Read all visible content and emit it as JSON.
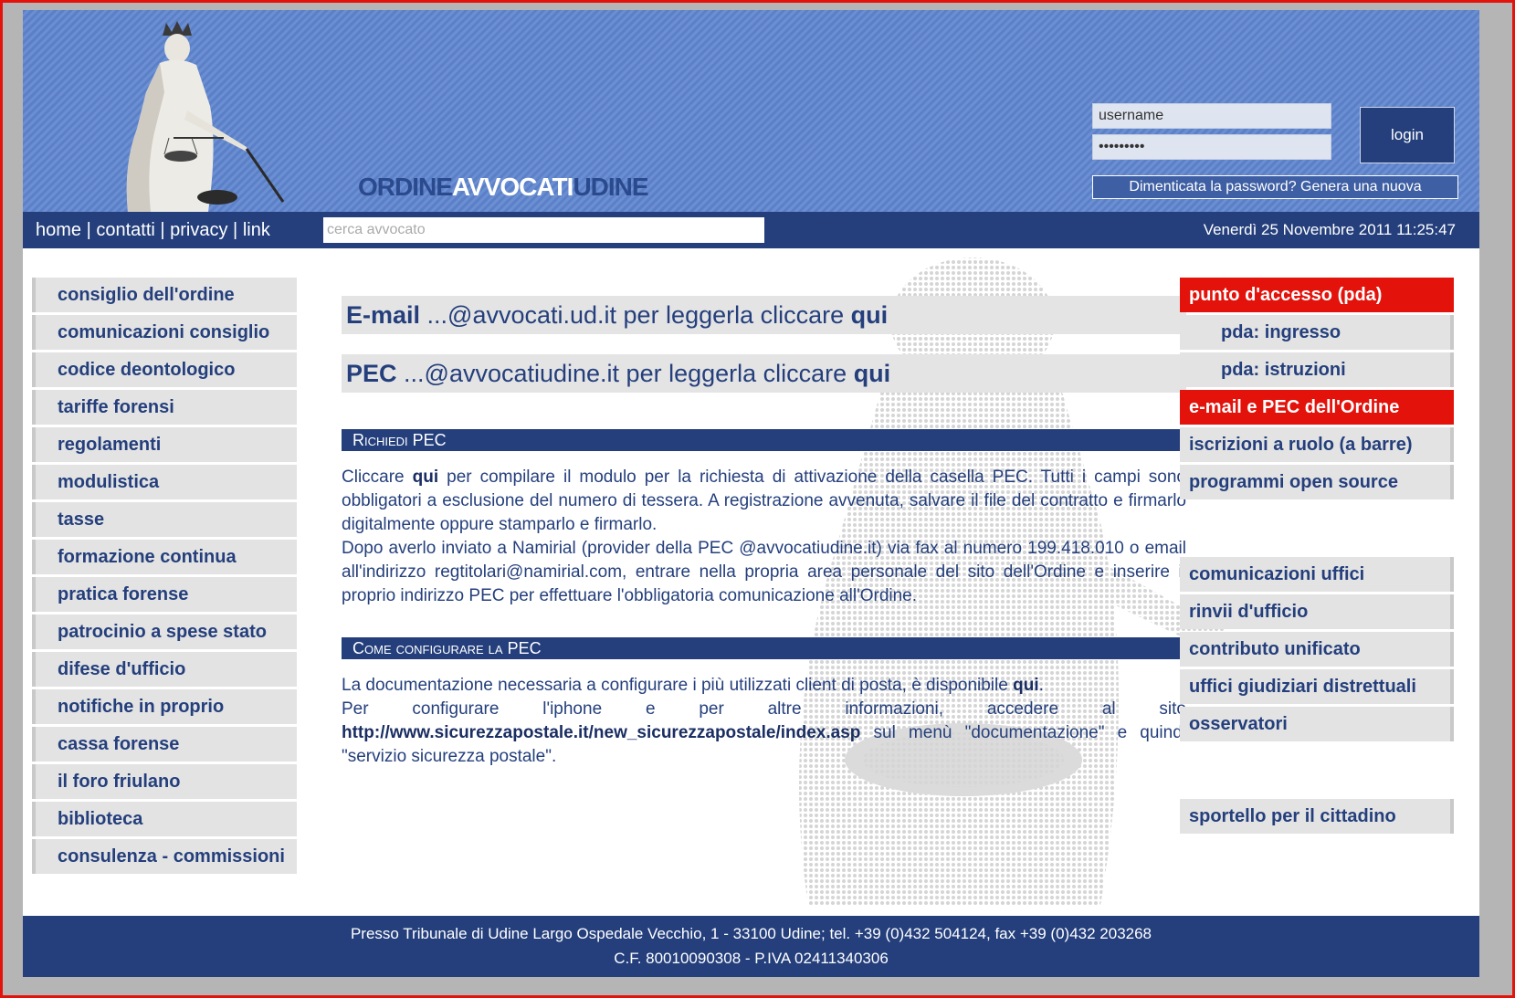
{
  "header": {
    "brand_part1": "ORDINE",
    "brand_part2": "AVVOCATI",
    "brand_part3": "UDINE",
    "username_value": "username",
    "password_value": "•••••••••",
    "login_label": "login",
    "forgot_label": "Dimenticata la password? Genera una nuova"
  },
  "nav": {
    "links": [
      "home",
      "contatti",
      "privacy",
      "link"
    ],
    "search_placeholder": "cerca avvocato",
    "datetime": "Venerdì 25 Novembre 2011 11:25:47"
  },
  "left_menu": [
    "consiglio dell'ordine",
    "comunicazioni consiglio",
    "codice deontologico",
    "tariffe forensi",
    "regolamenti",
    "modulistica",
    "tasse",
    "formazione continua",
    "pratica forense",
    "patrocinio a spese stato",
    "difese d'ufficio",
    "notifiche in proprio",
    "cassa forense",
    "il foro friulano",
    "biblioteca",
    "consulenza - commissioni"
  ],
  "right_menu": {
    "pda_header": "punto d'accesso (pda)",
    "pda_ingresso": "pda: ingresso",
    "pda_istruzioni": "pda: istruzioni",
    "email_pec_header": "e-mail e PEC dell'Ordine",
    "iscrizioni": "iscrizioni a ruolo (a barre)",
    "programmi": "programmi open source",
    "comunicazioni_uffici": "comunicazioni uffici",
    "rinvii": "rinvii d'ufficio",
    "contributo": "contributo unificato",
    "uffici_giudiziari": "uffici giudiziari distrettuali",
    "osservatori": "osservatori",
    "sportello": "sportello per il cittadino"
  },
  "content": {
    "email_label": "E-mail",
    "email_text": " ...@avvocati.ud.it per leggerla cliccare ",
    "email_link": "qui",
    "pec_label": "PEC",
    "pec_text": " ...@avvocatiudine.it per leggerla cliccare ",
    "pec_link": "qui",
    "section1_title": "Richiedi PEC",
    "section1_p_start": "Cliccare ",
    "section1_p_link": "qui",
    "section1_p_rest": " per compilare il modulo per la richiesta di attivazione della casella PEC. Tutti i campi sono obbligatori a esclusione del numero di tessera. A registrazione avvenuta, salvare il file del contratto e firmarlo digitalmente oppure stamparlo e firmarlo.",
    "section1_p2": "Dopo averlo inviato a Namirial (provider della PEC @avvocatiudine.it) via fax al numero 199.418.010 o email all'indirizzo regtitolari@namirial.com, entrare nella propria area personale del sito dell'Ordine e inserire il proprio indirizzo PEC per effettuare l'obbligatoria comunicazione all'Ordine.",
    "section2_title": "Come configurare la PEC",
    "section2_p1_start": "La documentazione necessaria a configurare i più utilizzati client di posta, è disponibile ",
    "section2_p1_link": "qui",
    "section2_p1_end": ".",
    "section2_p2_start": "Per configurare l'iphone e per altre informazioni, accedere al sito ",
    "section2_p2_link": "http://www.sicurezzapostale.it/new_sicurezzapostale/index.asp",
    "section2_p2_end": " sul menù \"documentazione\" e quindi \"servizio sicurezza postale\"."
  },
  "footer": {
    "line1": "Presso Tribunale di Udine Largo Ospedale Vecchio, 1 - 33100 Udine; tel. +39 (0)432 504124, fax +39 (0)432 203268",
    "line2": "C.F. 80010090308 - P.IVA 02411340306"
  }
}
